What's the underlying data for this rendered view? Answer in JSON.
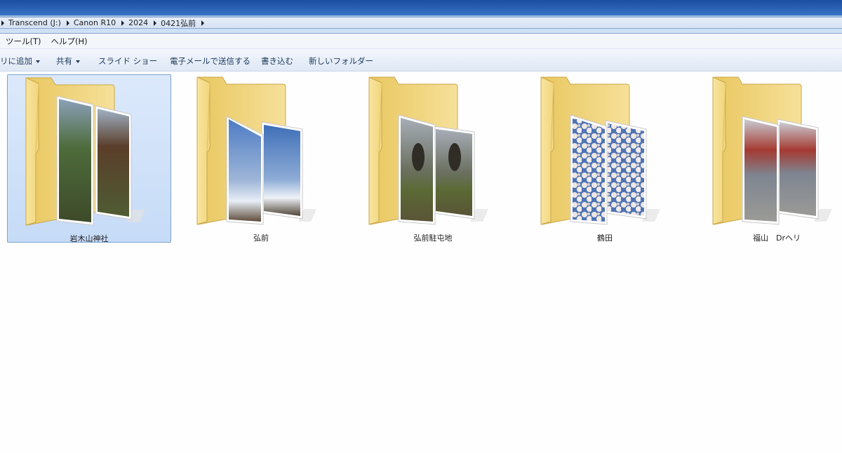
{
  "address": {
    "crumbs": [
      "Transcend (J:)",
      "Canon R10",
      "2024",
      "0421弘前"
    ]
  },
  "menu": {
    "items": [
      "ツール(T)",
      "ヘルプ(H)"
    ]
  },
  "toolbar": {
    "library": "リに追加",
    "share": "共有",
    "slideshow": "スライド ショー",
    "email": "電子メールで送信する",
    "burn": "書き込む",
    "new_folder": "新しいフォルダー"
  },
  "folders": [
    {
      "name": "岩木山神社",
      "selected": true
    },
    {
      "name": "弘前",
      "selected": false
    },
    {
      "name": "弘前駐屯地",
      "selected": false
    },
    {
      "name": "鶴田",
      "selected": false
    },
    {
      "name": "福山　Drヘリ",
      "selected": false
    }
  ],
  "colors": {
    "titlebar": "#2b63b8",
    "folder": "#f5d97a",
    "selection": "#c6dbf7"
  }
}
